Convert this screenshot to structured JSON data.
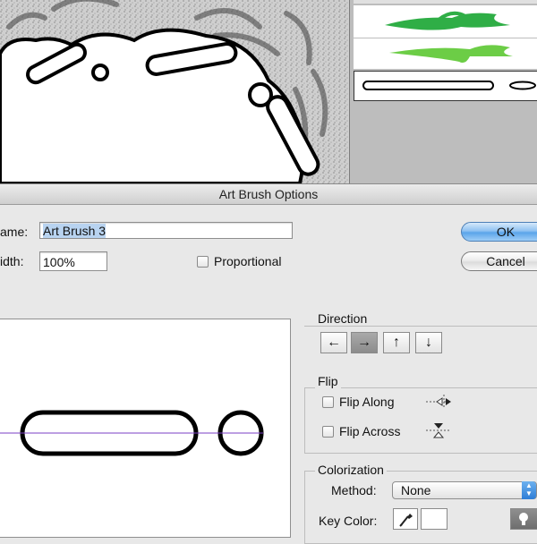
{
  "dialog": {
    "title": "Art Brush Options",
    "name_label": "ame:",
    "name_value": "Art Brush 3",
    "width_label": "idth:",
    "width_value": "100%",
    "proportional_label": "Proportional",
    "proportional_checked": false,
    "ok_label": "OK",
    "cancel_label": "Cancel"
  },
  "direction": {
    "title": "Direction",
    "buttons": [
      {
        "icon": "arrow-left-icon",
        "glyph": "←",
        "active": false
      },
      {
        "icon": "arrow-right-icon",
        "glyph": "→",
        "active": true
      },
      {
        "icon": "arrow-up-icon",
        "glyph": "↑",
        "active": false
      },
      {
        "icon": "arrow-down-icon",
        "glyph": "↓",
        "active": false
      }
    ]
  },
  "flip": {
    "title": "Flip",
    "along_label": "Flip Along",
    "across_label": "Flip Across"
  },
  "colorization": {
    "title": "Colorization",
    "method_label": "Method:",
    "method_value": "None",
    "key_color_label": "Key Color:"
  },
  "colors": {
    "accent_blue": "#5aa4ea",
    "brush_green": "#3cb44a",
    "guide_purple": "#7b3fc4",
    "selection": "#b8d3f0"
  }
}
